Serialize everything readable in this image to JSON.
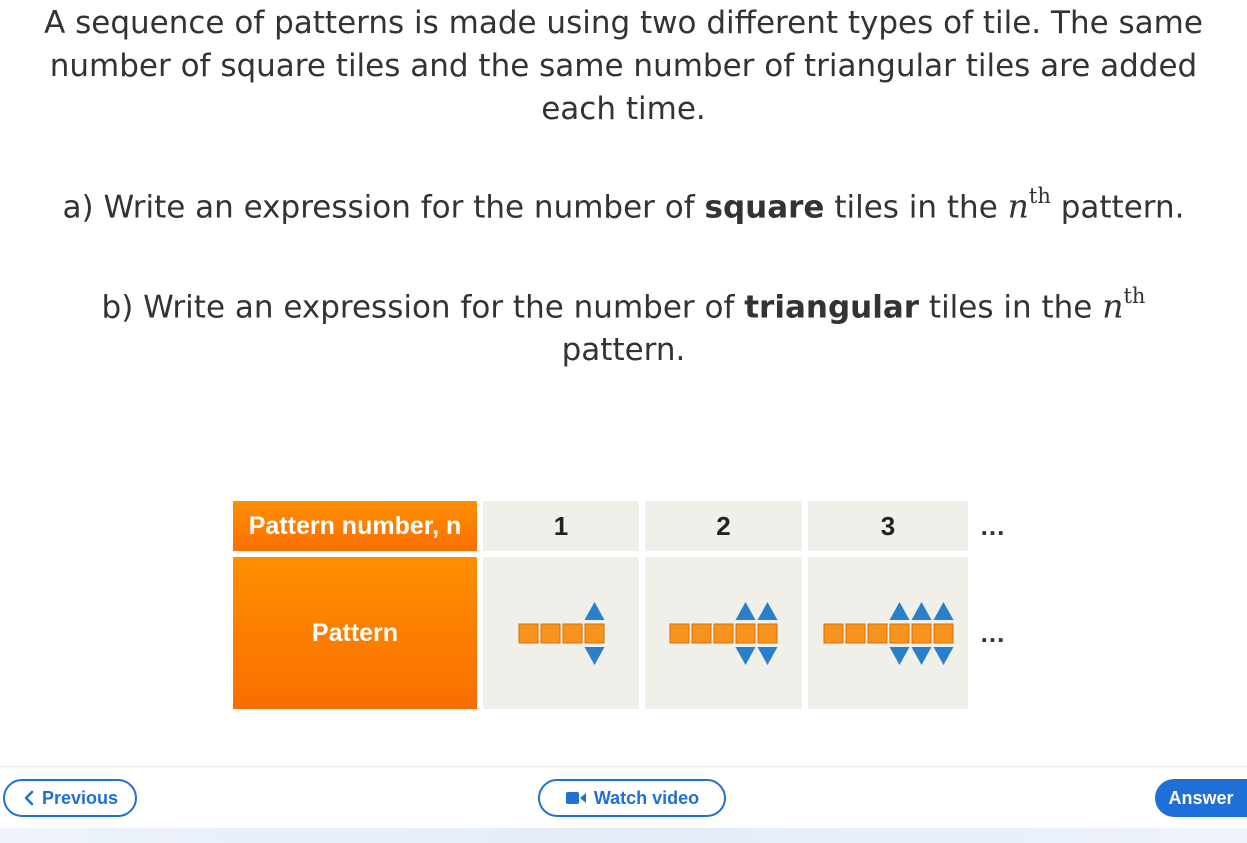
{
  "question": {
    "intro": "A sequence of patterns is made using two different types of tile. The same number of square tiles and the same number of triangular tiles are added each time.",
    "part_a": {
      "prefix": "a) Write an expression for the number of ",
      "bold": "square",
      "suffix": " tiles in the ",
      "var": "n",
      "sup": "th",
      "end": " pattern."
    },
    "part_b": {
      "prefix": "b) Write an expression for the number of ",
      "bold": "triangular",
      "suffix": " tiles in the ",
      "var": "n",
      "sup": "th",
      "end": " pattern."
    }
  },
  "table": {
    "row1_header": "Pattern number, n",
    "row2_header": "Pattern",
    "columns": [
      {
        "n": "1",
        "squares": 4,
        "triangles_up": 1,
        "triangles_down": 1
      },
      {
        "n": "2",
        "squares": 5,
        "triangles_up": 2,
        "triangles_down": 2
      },
      {
        "n": "3",
        "squares": 6,
        "triangles_up": 3,
        "triangles_down": 3
      }
    ],
    "continuation": "...",
    "colors": {
      "square": "#f7941d",
      "square_border": "#d86f00",
      "triangle": "#2a7fc9"
    }
  },
  "nav": {
    "previous": "Previous",
    "watch_video": "Watch video",
    "answer": "Answer",
    "accent": "#1f6fd8"
  }
}
